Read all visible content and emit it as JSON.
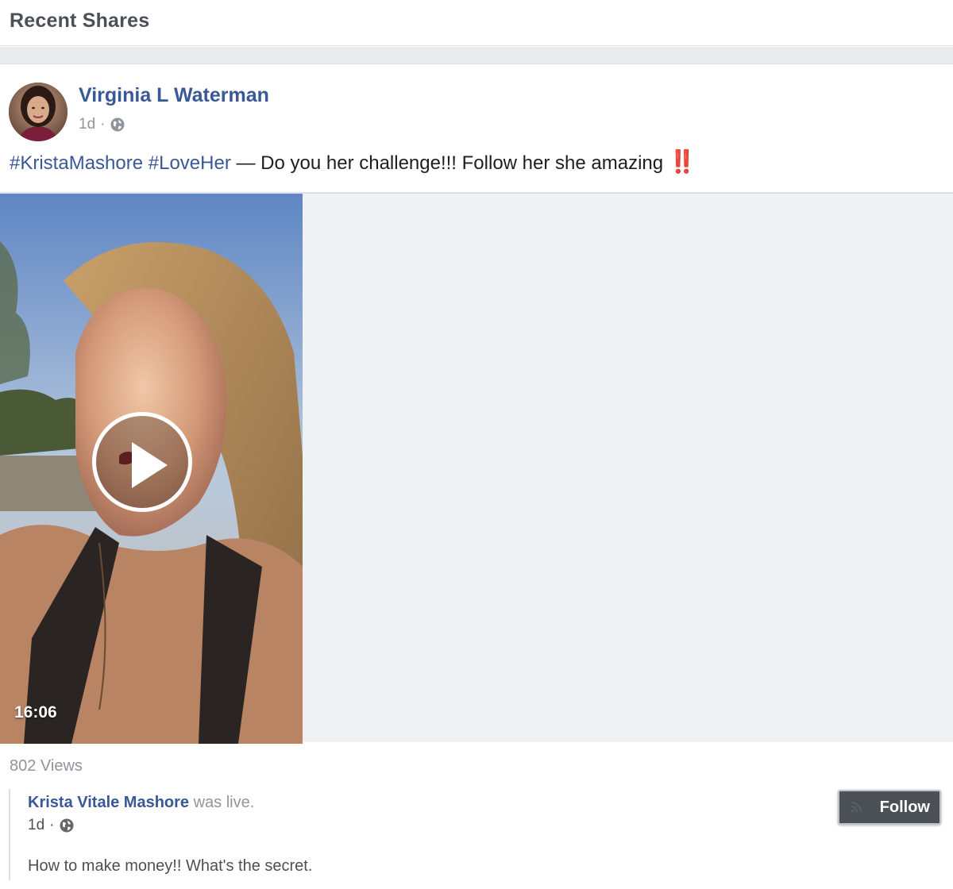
{
  "section": {
    "title": "Recent Shares"
  },
  "post": {
    "author": "Virginia L Waterman",
    "time": "1d",
    "separator": "·",
    "privacy_icon": "globe-icon",
    "hashtags": [
      "#KristaMashore",
      "#LoveHer"
    ],
    "dash": "—",
    "message": "Do you her challenge!!! Follow her she amazing",
    "emoji": "‼️",
    "video": {
      "duration": "16:06",
      "play_icon": "play-icon"
    },
    "views": "802 Views"
  },
  "shared": {
    "author": "Krista Vitale Mashore",
    "status": "was live.",
    "time": "1d",
    "separator": "·",
    "privacy_icon": "globe-icon",
    "caption": "How to make money!! What's the secret.",
    "follow_label": "Follow"
  },
  "colors": {
    "link": "#385898",
    "muted": "#90949c",
    "band": "#e9ebee",
    "media_bg": "#f0f1f4",
    "follow_bg": "#4b4f56"
  }
}
